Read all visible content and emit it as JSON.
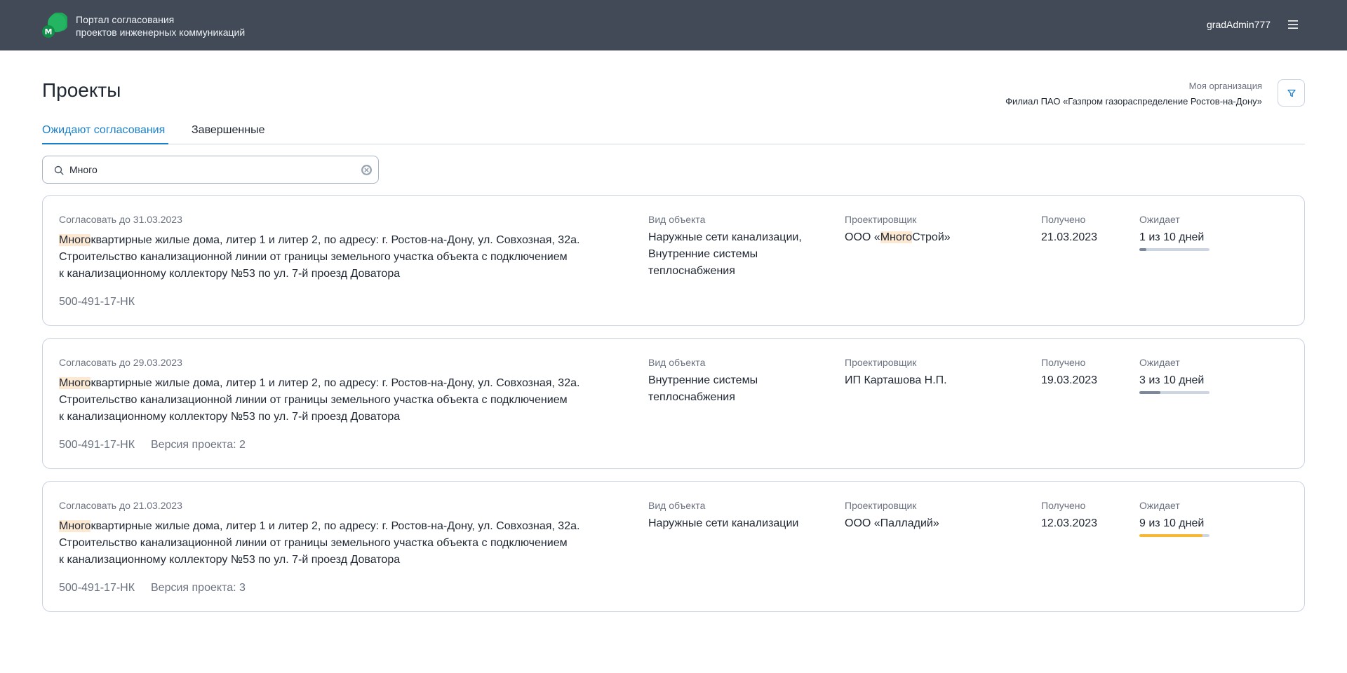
{
  "header": {
    "app_title_line1": "Портал согласования",
    "app_title_line2": "проектов инженерных коммуникаций",
    "logo_letter": "М",
    "user": "gradAdmin777"
  },
  "page": {
    "title": "Проекты",
    "org_label": "Моя организация",
    "org_name": "Филиал ПАО «Газпром газораспределение Ростов-на-Дону»"
  },
  "tabs": [
    {
      "label": "Ожидают согласования",
      "active": true
    },
    {
      "label": "Завершенные",
      "active": false
    }
  ],
  "search": {
    "value": "Много",
    "placeholder": ""
  },
  "labels": {
    "object_type": "Вид объекта",
    "designer": "Проектировщик",
    "received": "Получено",
    "waiting": "Ожидает"
  },
  "colors": {
    "header_bg": "#414a56",
    "accent": "#1a7fc9",
    "highlight": "#fde9d2",
    "progress_normal": "#7c8799",
    "progress_warning": "#f7b731",
    "progress_track": "#cdd5e1"
  },
  "projects": [
    {
      "due": "Согласовать до 31.03.2023",
      "desc_highlight": "Много",
      "desc_rest_line1": "квартирные жилые дома, литер 1 и литер 2, по адресу: г. Ростов-на-Дону, ул. Совхозная, 32а.",
      "desc_line2": "Строительство канализационной линии от границы земельного участка объекта с подключением",
      "desc_line3": "к канализационному коллектору №53 по ул. 7-й проезд Доватора",
      "code": "500-491-17-НК",
      "version": "",
      "object_type": "Наружные сети канализации, Внутренние системы теплоснабжения",
      "designer_pre": "ООО «",
      "designer_highlight": "Много",
      "designer_post": "Строй»",
      "received": "21.03.2023",
      "waiting": "1 из 10 дней",
      "progress": 0.1,
      "progress_status": "normal"
    },
    {
      "due": "Согласовать до 29.03.2023",
      "desc_highlight": "Много",
      "desc_rest_line1": "квартирные жилые дома, литер 1 и литер 2, по адресу: г. Ростов-на-Дону, ул. Совхозная, 32а.",
      "desc_line2": "Строительство канализационной линии от границы земельного участка объекта с подключением",
      "desc_line3": "к канализационному коллектору №53 по ул. 7-й проезд Доватора",
      "code": "500-491-17-НК",
      "version": "Версия проекта: 2",
      "object_type": "Внутренние системы теплоснабжения",
      "designer_pre": "ИП Карташова Н.П.",
      "designer_highlight": "",
      "designer_post": "",
      "received": "19.03.2023",
      "waiting": "3 из 10 дней",
      "progress": 0.3,
      "progress_status": "normal"
    },
    {
      "due": "Согласовать до 21.03.2023",
      "desc_highlight": "Много",
      "desc_rest_line1": "квартирные жилые дома, литер 1 и литер 2, по адресу: г. Ростов-на-Дону, ул. Совхозная, 32а.",
      "desc_line2": "Строительство канализационной линии от границы земельного участка объекта с подключением",
      "desc_line3": "к канализационному коллектору №53 по ул. 7-й проезд Доватора",
      "code": "500-491-17-НК",
      "version": "Версия проекта: 3",
      "object_type": "Наружные сети канализации",
      "designer_pre": "ООО «Палладий»",
      "designer_highlight": "",
      "designer_post": "",
      "received": "12.03.2023",
      "waiting": "9 из 10 дней",
      "progress": 0.9,
      "progress_status": "warning"
    }
  ]
}
